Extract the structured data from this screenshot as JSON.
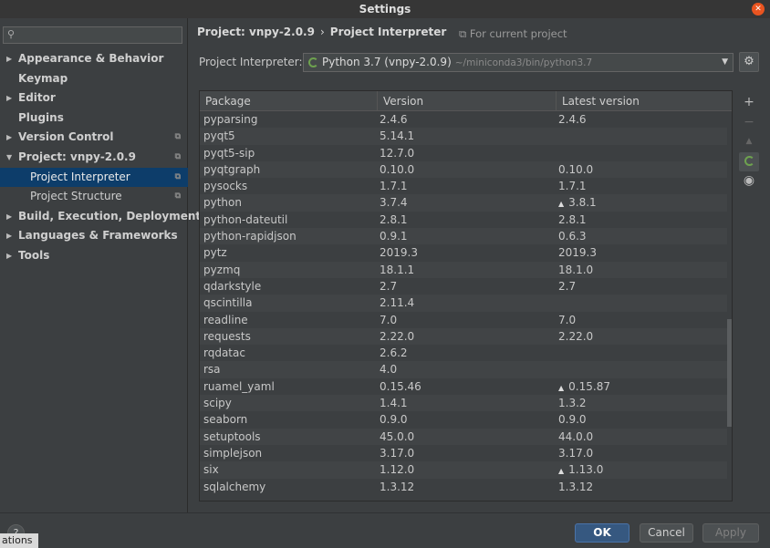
{
  "window": {
    "title": "Settings",
    "close_glyph": "✕"
  },
  "sidebar": {
    "search_placeholder": "",
    "items": [
      {
        "label": "Appearance & Behavior",
        "arrow": "▶"
      },
      {
        "label": "Keymap",
        "arrow": ""
      },
      {
        "label": "Editor",
        "arrow": "▶"
      },
      {
        "label": "Plugins",
        "arrow": ""
      },
      {
        "label": "Version Control",
        "arrow": "▶"
      },
      {
        "label": "Project: vnpy-2.0.9",
        "arrow": "▼"
      },
      {
        "label": "Project Interpreter",
        "arrow": ""
      },
      {
        "label": "Project Structure",
        "arrow": ""
      },
      {
        "label": "Build, Execution, Deployment",
        "arrow": "▶"
      },
      {
        "label": "Languages & Frameworks",
        "arrow": "▶"
      },
      {
        "label": "Tools",
        "arrow": "▶"
      }
    ]
  },
  "header": {
    "crumb_project": "Project: vnpy-2.0.9",
    "crumb_sep": "›",
    "crumb_page": "Project Interpreter",
    "for_current": "For current project"
  },
  "interpreter": {
    "label": "Project Interpreter:",
    "name": "Python 3.7 (vnpy-2.0.9)",
    "path": "~/miniconda3/bin/python3.7"
  },
  "table": {
    "headers": {
      "package": "Package",
      "version": "Version",
      "latest": "Latest version"
    },
    "rows": [
      {
        "package": "pyparsing",
        "version": "2.4.6",
        "latest": "2.4.6",
        "upgrade": false
      },
      {
        "package": "pyqt5",
        "version": "5.14.1",
        "latest": "",
        "upgrade": false
      },
      {
        "package": "pyqt5-sip",
        "version": "12.7.0",
        "latest": "",
        "upgrade": false
      },
      {
        "package": "pyqtgraph",
        "version": "0.10.0",
        "latest": "0.10.0",
        "upgrade": false
      },
      {
        "package": "pysocks",
        "version": "1.7.1",
        "latest": "1.7.1",
        "upgrade": false
      },
      {
        "package": "python",
        "version": "3.7.4",
        "latest": "3.8.1",
        "upgrade": true
      },
      {
        "package": "python-dateutil",
        "version": "2.8.1",
        "latest": "2.8.1",
        "upgrade": false
      },
      {
        "package": "python-rapidjson",
        "version": "0.9.1",
        "latest": "0.6.3",
        "upgrade": false
      },
      {
        "package": "pytz",
        "version": "2019.3",
        "latest": "2019.3",
        "upgrade": false
      },
      {
        "package": "pyzmq",
        "version": "18.1.1",
        "latest": "18.1.0",
        "upgrade": false
      },
      {
        "package": "qdarkstyle",
        "version": "2.7",
        "latest": "2.7",
        "upgrade": false
      },
      {
        "package": "qscintilla",
        "version": "2.11.4",
        "latest": "",
        "upgrade": false
      },
      {
        "package": "readline",
        "version": "7.0",
        "latest": "7.0",
        "upgrade": false
      },
      {
        "package": "requests",
        "version": "2.22.0",
        "latest": "2.22.0",
        "upgrade": false
      },
      {
        "package": "rqdatac",
        "version": "2.6.2",
        "latest": "",
        "upgrade": false
      },
      {
        "package": "rsa",
        "version": "4.0",
        "latest": "",
        "upgrade": false
      },
      {
        "package": "ruamel_yaml",
        "version": "0.15.46",
        "latest": "0.15.87",
        "upgrade": true
      },
      {
        "package": "scipy",
        "version": "1.4.1",
        "latest": "1.3.2",
        "upgrade": false
      },
      {
        "package": "seaborn",
        "version": "0.9.0",
        "latest": "0.9.0",
        "upgrade": false
      },
      {
        "package": "setuptools",
        "version": "45.0.0",
        "latest": "44.0.0",
        "upgrade": false
      },
      {
        "package": "simplejson",
        "version": "3.17.0",
        "latest": "3.17.0",
        "upgrade": false
      },
      {
        "package": "six",
        "version": "1.12.0",
        "latest": "1.13.0",
        "upgrade": true
      },
      {
        "package": "sqlalchemy",
        "version": "1.3.12",
        "latest": "1.3.12",
        "upgrade": false
      }
    ],
    "upgrade_glyph": "▲"
  },
  "tools": {
    "add": "+",
    "remove": "−",
    "upgrade": "▲",
    "eye": "◉"
  },
  "footer": {
    "ok": "OK",
    "cancel": "Cancel",
    "apply": "Apply",
    "help": "?",
    "tooltip": "ations"
  }
}
